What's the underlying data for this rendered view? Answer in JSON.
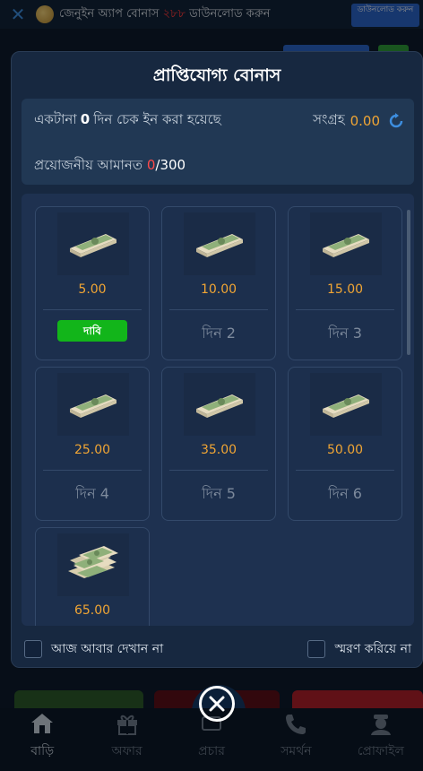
{
  "topbar": {
    "promo_prefix": "জেনুইন অ্যাপ বোনাস ",
    "promo_number": "২৮৮",
    "promo_suffix": " ডাউনলোড করুন",
    "download_label": "ডাউনলোড করুন"
  },
  "modal": {
    "title": "প্রাপ্তিযোগ্য বোনাস",
    "streak_prefix": "একটানা",
    "streak_days": "0",
    "streak_suffix": "দিন চেক ইন করা হয়েছে",
    "collect_label": "সংগ্রহ",
    "collect_amount": "0.00",
    "deposit_label": "প্রয়োজনীয় আমানত",
    "deposit_current": "0",
    "deposit_total": "/300"
  },
  "cards": [
    {
      "amount": "5.00",
      "action": "দাবি"
    },
    {
      "amount": "10.00",
      "day": "দিন 2"
    },
    {
      "amount": "15.00",
      "day": "দিন 3"
    },
    {
      "amount": "25.00",
      "day": "দিন 4"
    },
    {
      "amount": "35.00",
      "day": "দিন 5"
    },
    {
      "amount": "50.00",
      "day": "দিন 6"
    },
    {
      "amount": "65.00"
    }
  ],
  "footer": {
    "dont_show_today": "আজ আবার দেখান না",
    "remind_me": "স্মরণ করিয়ে না"
  },
  "bottom_nav": [
    {
      "label": "বাড়ি",
      "icon": "home-icon"
    },
    {
      "label": "অফার",
      "icon": "gift-icon"
    },
    {
      "label": "প্রচার",
      "icon": "promotion-icon"
    },
    {
      "label": "সমর্থন",
      "icon": "phone-icon"
    },
    {
      "label": "প্রোফাইল",
      "icon": "profile-icon"
    }
  ],
  "colors": {
    "accent_amount": "#f0a534",
    "claim_button": "#12b51a",
    "deposit_current": "#ff4a4a",
    "primary_blue": "#2a65c9"
  }
}
